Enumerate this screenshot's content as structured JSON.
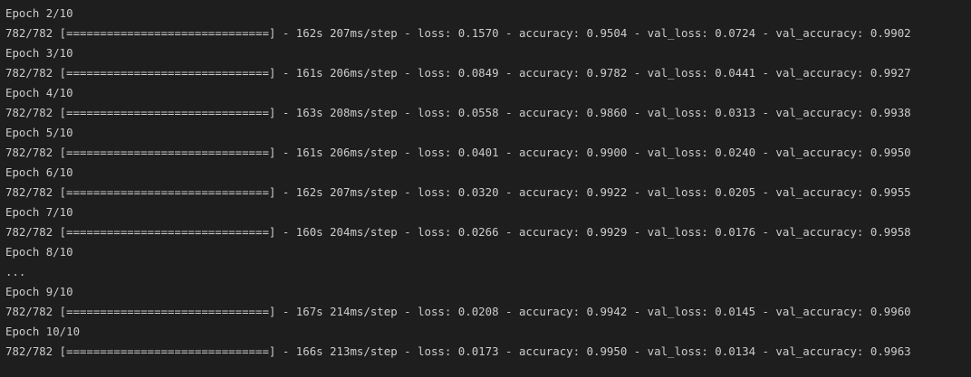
{
  "output": {
    "lines": [
      "Epoch 2/10",
      "782/782 [==============================] - 162s 207ms/step - loss: 0.1570 - accuracy: 0.9504 - val_loss: 0.0724 - val_accuracy: 0.9902",
      "Epoch 3/10",
      "782/782 [==============================] - 161s 206ms/step - loss: 0.0849 - accuracy: 0.9782 - val_loss: 0.0441 - val_accuracy: 0.9927",
      "Epoch 4/10",
      "782/782 [==============================] - 163s 208ms/step - loss: 0.0558 - accuracy: 0.9860 - val_loss: 0.0313 - val_accuracy: 0.9938",
      "Epoch 5/10",
      "782/782 [==============================] - 161s 206ms/step - loss: 0.0401 - accuracy: 0.9900 - val_loss: 0.0240 - val_accuracy: 0.9950",
      "Epoch 6/10",
      "782/782 [==============================] - 162s 207ms/step - loss: 0.0320 - accuracy: 0.9922 - val_loss: 0.0205 - val_accuracy: 0.9955",
      "Epoch 7/10",
      "782/782 [==============================] - 160s 204ms/step - loss: 0.0266 - accuracy: 0.9929 - val_loss: 0.0176 - val_accuracy: 0.9958",
      "Epoch 8/10",
      "...",
      "Epoch 9/10",
      "782/782 [==============================] - 167s 214ms/step - loss: 0.0208 - accuracy: 0.9942 - val_loss: 0.0145 - val_accuracy: 0.9960",
      "Epoch 10/10",
      "782/782 [==============================] - 166s 213ms/step - loss: 0.0173 - accuracy: 0.9950 - val_loss: 0.0134 - val_accuracy: 0.9963"
    ]
  },
  "colors": {
    "background": "#1e1e1e",
    "text": "#cccccc"
  }
}
